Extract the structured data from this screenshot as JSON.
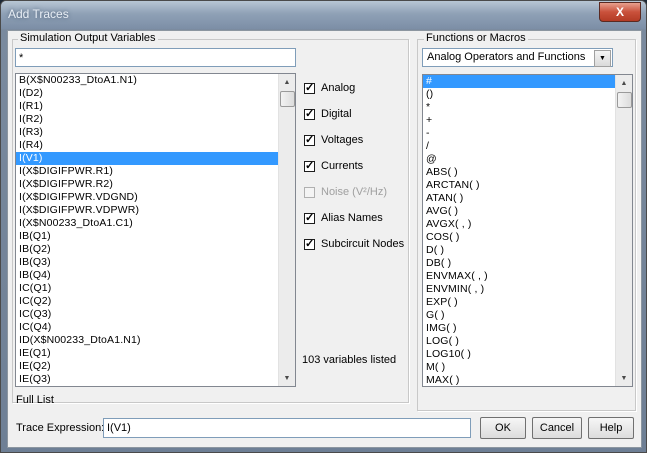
{
  "window": {
    "title": "Add Traces",
    "close_glyph": "X"
  },
  "left_panel": {
    "group_label": "Simulation Output Variables",
    "filter_value": "*",
    "list_items": [
      "B(X$N00233_DtoA1.N1)",
      "I(D2)",
      "I(R1)",
      "I(R2)",
      "I(R3)",
      "I(R4)",
      "I(V1)",
      "I(X$DIGIFPWR.R1)",
      "I(X$DIGIFPWR.R2)",
      "I(X$DIGIFPWR.VDGND)",
      "I(X$DIGIFPWR.VDPWR)",
      "I(X$N00233_DtoA1.C1)",
      "IB(Q1)",
      "IB(Q2)",
      "IB(Q3)",
      "IB(Q4)",
      "IC(Q1)",
      "IC(Q2)",
      "IC(Q3)",
      "IC(Q4)",
      "ID(X$N00233_DtoA1.N1)",
      "IE(Q1)",
      "IE(Q2)",
      "IE(Q3)"
    ],
    "selected_index": 6,
    "footer_label": "Full List"
  },
  "filters": {
    "analog": {
      "label": "Analog",
      "checked": true,
      "enabled": true
    },
    "digital": {
      "label": "Digital",
      "checked": true,
      "enabled": true
    },
    "voltages": {
      "label": "Voltages",
      "checked": true,
      "enabled": true
    },
    "currents": {
      "label": "Currents",
      "checked": true,
      "enabled": true
    },
    "noise": {
      "label": "Noise (V²/Hz)",
      "checked": false,
      "enabled": false
    },
    "alias_names": {
      "label": "Alias Names",
      "checked": true,
      "enabled": true
    },
    "subcircuit_nodes": {
      "label": "Subcircuit Nodes",
      "checked": true,
      "enabled": true
    },
    "count_text": "103 variables listed"
  },
  "right_panel": {
    "group_label": "Functions or Macros",
    "dropdown_value": "Analog Operators and Functions",
    "list_items": [
      "#",
      "()",
      "*",
      "+",
      "-",
      "/",
      "@",
      "ABS( )",
      "ARCTAN( )",
      "ATAN( )",
      "AVG( )",
      "AVGX( , )",
      "COS( )",
      "D( )",
      "DB( )",
      "ENVMAX( , )",
      "ENVMIN( , )",
      "EXP( )",
      "G( )",
      "IMG( )",
      "LOG( )",
      "LOG10( )",
      "M( )",
      "MAX( )"
    ],
    "selected_index": 0
  },
  "bottom": {
    "trace_label": "Trace Expression:",
    "trace_value": "I(V1)",
    "ok_label": "OK",
    "cancel_label": "Cancel",
    "help_label": "Help"
  },
  "colors": {
    "selection": "#3399ff",
    "window_face": "#f0f0f0"
  }
}
